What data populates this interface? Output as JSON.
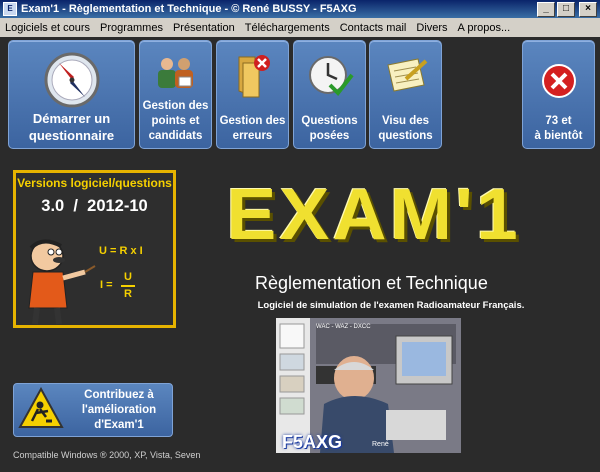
{
  "window": {
    "title": "Exam'1 - Règlementation et Technique - © René BUSSY - F5AXG"
  },
  "window_controls": {
    "minimize": "_",
    "maximize": "□",
    "close": "×"
  },
  "menu": [
    "Logiciels et cours",
    "Programmes",
    "Présentation",
    "Téléchargements",
    "Contacts mail",
    "Divers",
    "A propos..."
  ],
  "toolbar": [
    {
      "label": "Démarrer un\nquestionnaire",
      "icon": "compass-icon"
    },
    {
      "label": "Gestion des\npoints et\ncandidats",
      "icon": "people-icon"
    },
    {
      "label": "Gestion des\nerreurs",
      "icon": "folder-error-icon"
    },
    {
      "label": "Questions\nposées",
      "icon": "clock-check-icon"
    },
    {
      "label": "Visu des\nquestions",
      "icon": "notepad-icon"
    },
    {
      "label": "73 et\nà bientôt",
      "icon": "close-red-icon"
    }
  ],
  "board": {
    "header": "Versions logiciel/questions",
    "version": "3.0  /  2012-10",
    "formula1": "U = R x I",
    "formula2_left": "I =",
    "formula2_num": "U",
    "formula2_den": "R"
  },
  "logo": "EXAM'1",
  "subtitle": "Règlementation et Technique",
  "tagline": "Logiciel de simulation de l'examen Radioamateur Français.",
  "photo": {
    "callsign": "F5AXG",
    "caption": "René",
    "banner": "WAC - WAZ - DXCC"
  },
  "contribute": {
    "label": "Contribuez à\nl'amélioration\nd'Exam'1",
    "icon": "worker-sign-icon"
  },
  "compat": "Compatible Windows ® 2000, XP, Vista, Seven"
}
